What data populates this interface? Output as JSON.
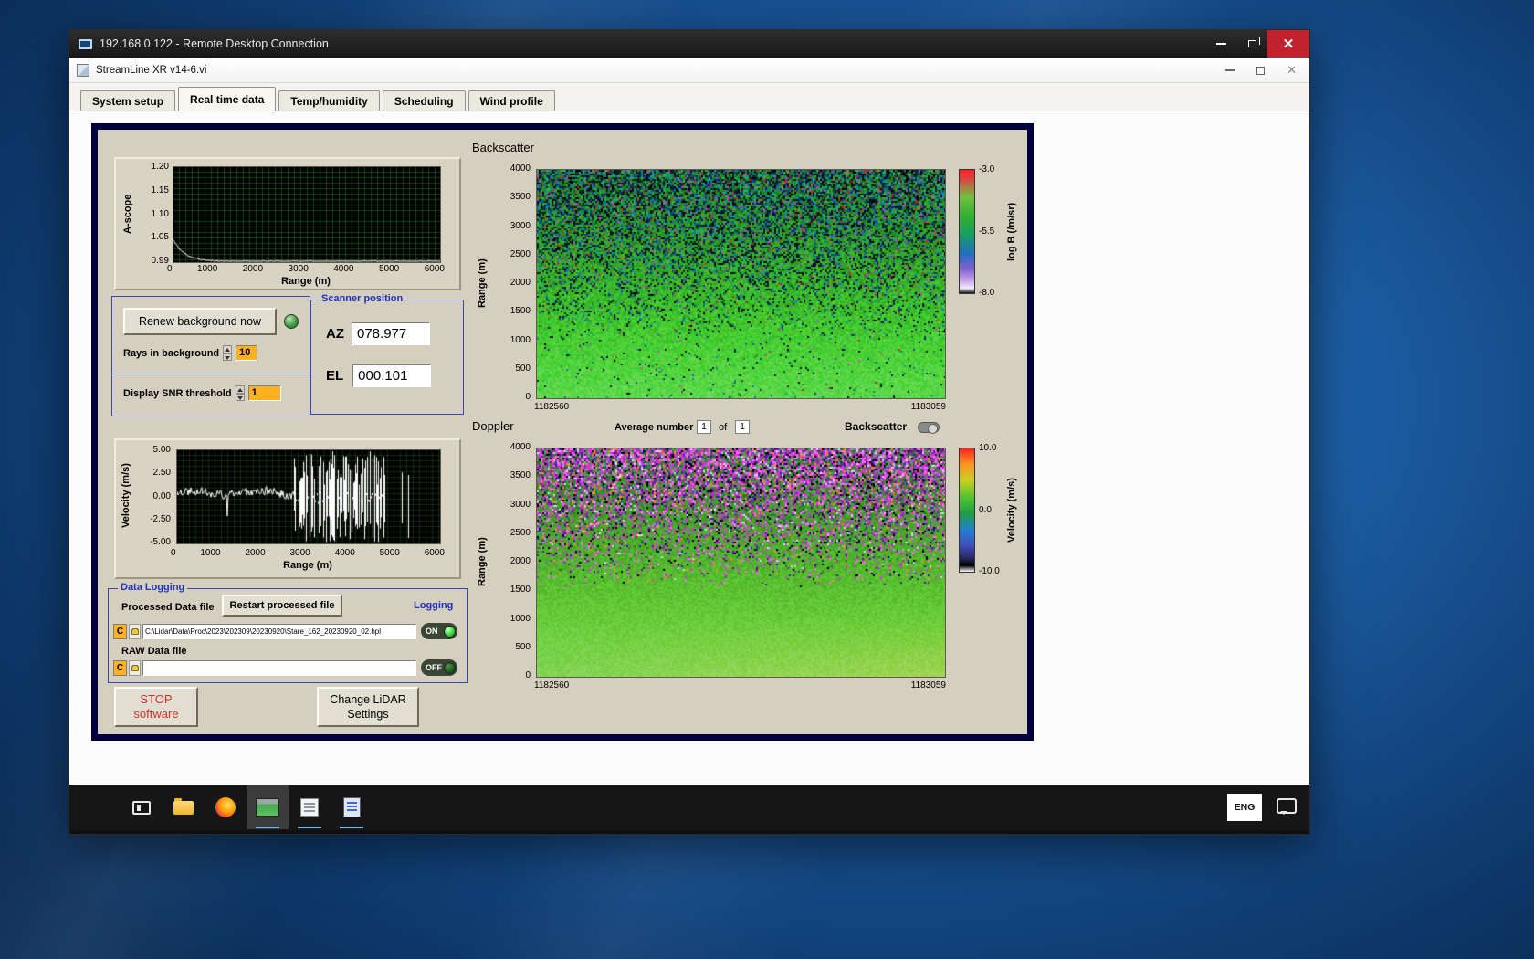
{
  "rdp": {
    "title": "192.168.0.122 - Remote Desktop Connection"
  },
  "app": {
    "title": "StreamLine XR v14-6.vi",
    "tabs": [
      {
        "label": "System setup",
        "active": false
      },
      {
        "label": "Real time data",
        "active": true
      },
      {
        "label": "Temp/humidity",
        "active": false
      },
      {
        "label": "Scheduling",
        "active": false
      },
      {
        "label": "Wind profile",
        "active": false
      }
    ]
  },
  "panel": {
    "backscatter_title": "Backscatter",
    "doppler_title": "Doppler",
    "controls": {
      "renew_button": "Renew background now",
      "rays_label": "Rays in background",
      "rays_value": "10",
      "snr_label": "Display SNR threshold",
      "snr_value": "1"
    },
    "scanner": {
      "title": "Scanner position",
      "az_label": "AZ",
      "az_value": "078.977",
      "el_label": "EL",
      "el_value": "000.101"
    },
    "doppler_bar": {
      "avg_label": "Average number",
      "avg_value": "1",
      "of_label": "of",
      "avg_total": "1",
      "toggle_label": "Backscatter"
    },
    "logging": {
      "title": "Data Logging",
      "processed_label": "Processed Data file",
      "restart_button": "Restart processed file",
      "logging_label": "Logging",
      "drive_label": "C",
      "processed_path": "C:\\Lidar\\Data\\Proc\\2023\\202309\\20230920\\Stare_162_20230920_02.hpl",
      "on_label": "ON",
      "raw_label": "RAW Data file",
      "raw_path": "",
      "off_label": "OFF"
    },
    "stop_button": {
      "line1": "STOP",
      "line2": "software"
    },
    "change_button": {
      "line1": "Change LiDAR",
      "line2": "Settings"
    }
  },
  "taskbar": {
    "language": "ENG"
  },
  "colors": {
    "panel_tan": "#d4cfbe",
    "panel_border_navy": "#00003f",
    "group_border_blue": "#3a49a8",
    "control_orange": "#ffb020",
    "led_green": "#35d435",
    "stop_red": "#cf2f2f",
    "close_red": "#c2212e"
  },
  "chart_data": [
    {
      "id": "ascope",
      "type": "line",
      "title": "",
      "ylabel": "A-scope",
      "xlabel": "Range (m)",
      "xlim": [
        0,
        6000
      ],
      "ylim": [
        0.99,
        1.2
      ],
      "xticks": [
        "0",
        "1000",
        "2000",
        "3000",
        "4000",
        "5000",
        "6000"
      ],
      "yticks": [
        "1.20",
        "1.15",
        "1.10",
        "1.05",
        "0.99"
      ],
      "grid": true,
      "plot_bg": "#000000",
      "line_color": "#ffffff",
      "description": "White trace starting near 1.04 at range 0, decaying to ~0.99 by ~500 m, then flat with small noise out to 6000 m"
    },
    {
      "id": "backscatter",
      "type": "heatmap",
      "title": "Backscatter",
      "ylabel": "Range (m)",
      "ylim": [
        0,
        4000
      ],
      "yticks": [
        "4000",
        "3500",
        "3000",
        "2500",
        "2000",
        "1500",
        "1000",
        "500",
        "0"
      ],
      "x_start": "1182560",
      "x_end": "1183059",
      "colorbar": {
        "label": "log B (/m/sr)",
        "ticks": [
          "-3.0",
          "-5.5",
          "-8.0"
        ],
        "range": [
          -3.0,
          -8.0
        ]
      },
      "description": "Speckled blue/green/dark noise at high ranges transitioning to smooth bright green backscatter below ~1000 m"
    },
    {
      "id": "doppler",
      "type": "heatmap",
      "title": "Doppler",
      "ylabel": "Range (m)",
      "ylim": [
        0,
        4000
      ],
      "yticks": [
        "4000",
        "3500",
        "3000",
        "2500",
        "2000",
        "1500",
        "1000",
        "500",
        "0"
      ],
      "x_start": "1182560",
      "x_end": "1183059",
      "colorbar": {
        "label": "Velocity (m/s)",
        "ticks": [
          "10.0",
          "0.0",
          "-10.0"
        ],
        "range": [
          10.0,
          -10.0
        ]
      },
      "description": "Magenta/purple/black noise above ~2000 m over smooth green near-zero velocities at low ranges, slightly yellow-green at bottom right"
    },
    {
      "id": "velocity",
      "type": "line",
      "title": "",
      "ylabel": "Velocity (m/s)",
      "xlabel": "Range (m)",
      "xlim": [
        0,
        6000
      ],
      "ylim": [
        -5,
        5
      ],
      "xticks": [
        "0",
        "1000",
        "2000",
        "3000",
        "4000",
        "5000",
        "6000"
      ],
      "yticks": [
        "5.00",
        "2.50",
        "0.00",
        "-2.50",
        "-5.00"
      ],
      "grid": true,
      "plot_bg": "#000000",
      "line_color": "#ffffff",
      "description": "White velocity trace near 0.5 m/s out to ~2600 m, then dense saturated full-scale spikes from ~2700-4700 m and sparse spikes beyond"
    }
  ]
}
